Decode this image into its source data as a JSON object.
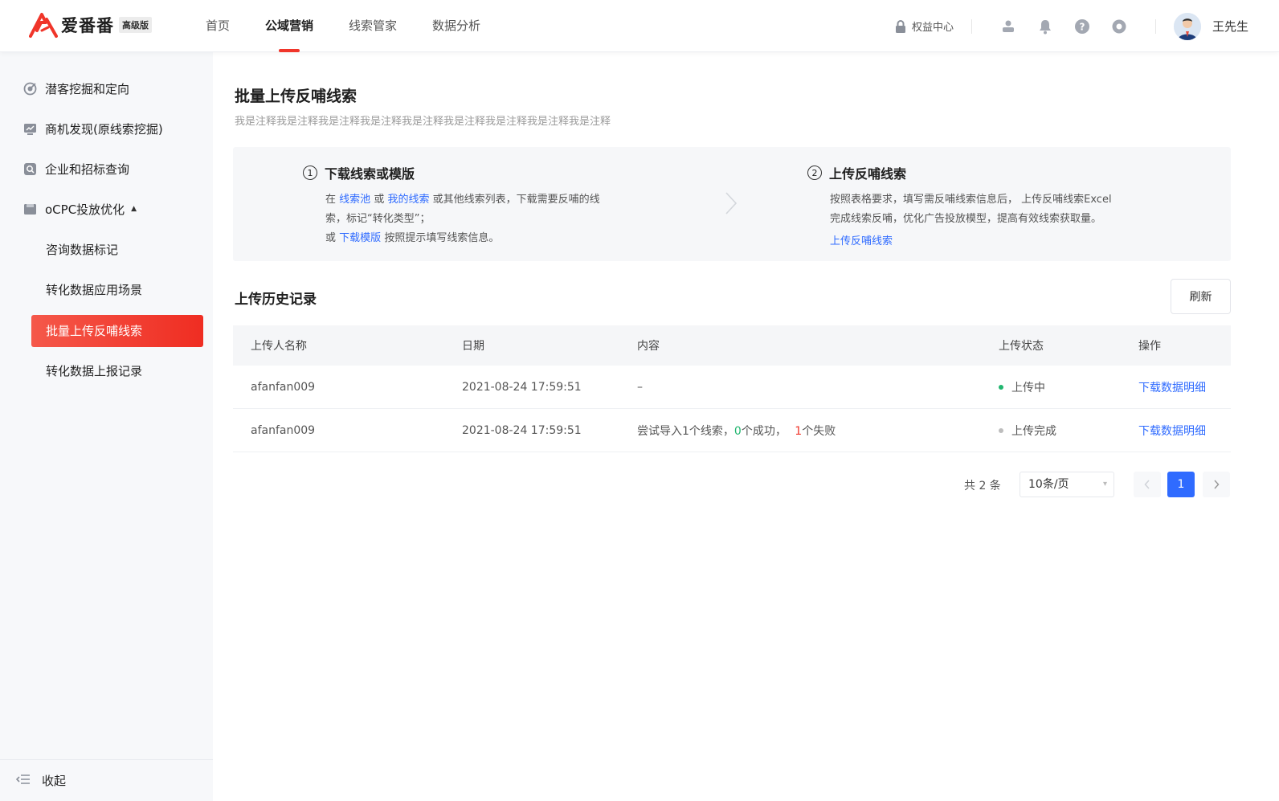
{
  "app": {
    "logo_text": "爱番番",
    "logo_badge": "高级版"
  },
  "topnav": {
    "items": [
      "首页",
      "公域营销",
      "线索管家",
      "数据分析"
    ],
    "active_index": 1
  },
  "header": {
    "rights_label": "权益中心",
    "user_name": "王先生"
  },
  "sidebar": {
    "items": [
      {
        "label": "潜客挖掘和定向",
        "icon": "target-icon"
      },
      {
        "label": "商机发现(原线索挖掘)",
        "icon": "monitor-icon"
      },
      {
        "label": "企业和招标查询",
        "icon": "search-doc-icon"
      },
      {
        "label": "oCPC投放优化",
        "icon": "folder-icon",
        "expanded": true
      }
    ],
    "sub_items": [
      "咨询数据标记",
      "转化数据应用场景",
      "批量上传反哺线索",
      "转化数据上报记录"
    ],
    "active_sub_index": 2,
    "collapse_label": "收起"
  },
  "page": {
    "title": "批量上传反哺线索",
    "description": "我是注释我是注释我是注释我是注释我是注释我是注释我是注释我是注释我是注释"
  },
  "steps": {
    "step1": {
      "num": "1",
      "title": "下载线索或模版",
      "line1_pre": "在",
      "link_pool": "线索池",
      "line1_or": "或",
      "link_mine": "我的线索",
      "line1_post": "或其他线索列表，下载需要反哺的线",
      "line2": "索，标记“转化类型”；",
      "line3_pre": "或",
      "link_template": "下载模版",
      "line3_post": "按照提示填写线索信息。"
    },
    "step2": {
      "num": "2",
      "title": "上传反哺线索",
      "line1": "按照表格要求，填写需反哺线索信息后，  上传反哺线索Excel",
      "line2": "完成线索反哺，优化广告投放模型，提高有效线索获取量。",
      "link_upload": "上传反哺线索"
    }
  },
  "history": {
    "title": "上传历史记录",
    "refresh_label": "刷新",
    "columns": [
      "上传人名称",
      "日期",
      "内容",
      "上传状态",
      "操作"
    ],
    "rows": [
      {
        "uploader": "afanfan009",
        "date": "2021-08-24 17:59:51",
        "content": "–",
        "status": "上传中",
        "status_color": "#21b66f",
        "action": "下载数据明细"
      },
      {
        "uploader": "afanfan009",
        "date": "2021-08-24 17:59:51",
        "content_pre": "尝试导入1个线索，",
        "success_count": "0",
        "success_text": "个成功，",
        "fail_count": "1",
        "fail_text": "个失败",
        "status": "上传完成",
        "status_color": "#bdbdbd",
        "action": "下载数据明细"
      }
    ]
  },
  "pagination": {
    "total_text": "共 2 条",
    "page_size": "10条/页",
    "current_page": "1"
  },
  "colors": {
    "accent": "#f0352a",
    "link": "#2f6bff",
    "success": "#21b66f"
  }
}
